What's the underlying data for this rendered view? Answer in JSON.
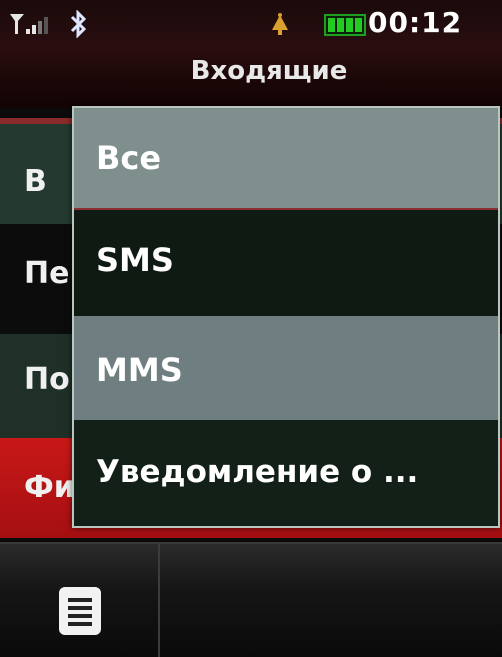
{
  "status_bar": {
    "time": "00:12",
    "icons": [
      "signal-icon",
      "bluetooth-icon",
      "alarm-icon",
      "battery-icon"
    ],
    "battery_color": "#22cc22"
  },
  "header": {
    "title": "Входящие"
  },
  "background_list": {
    "items": [
      {
        "label": "В"
      },
      {
        "label": "Пе"
      },
      {
        "label": "По"
      },
      {
        "label": "Фи"
      }
    ]
  },
  "popup_menu": {
    "items": [
      {
        "label": "Все"
      },
      {
        "label": "SMS"
      },
      {
        "label": "MMS"
      },
      {
        "label": "Уведомление о ..."
      }
    ]
  },
  "softkeys": {
    "left_icon": "menu-icon"
  },
  "colors": {
    "accent_red": "#c81818",
    "popup_highlight": "#7f8f8d",
    "popup_dark": "#0e1a12"
  }
}
